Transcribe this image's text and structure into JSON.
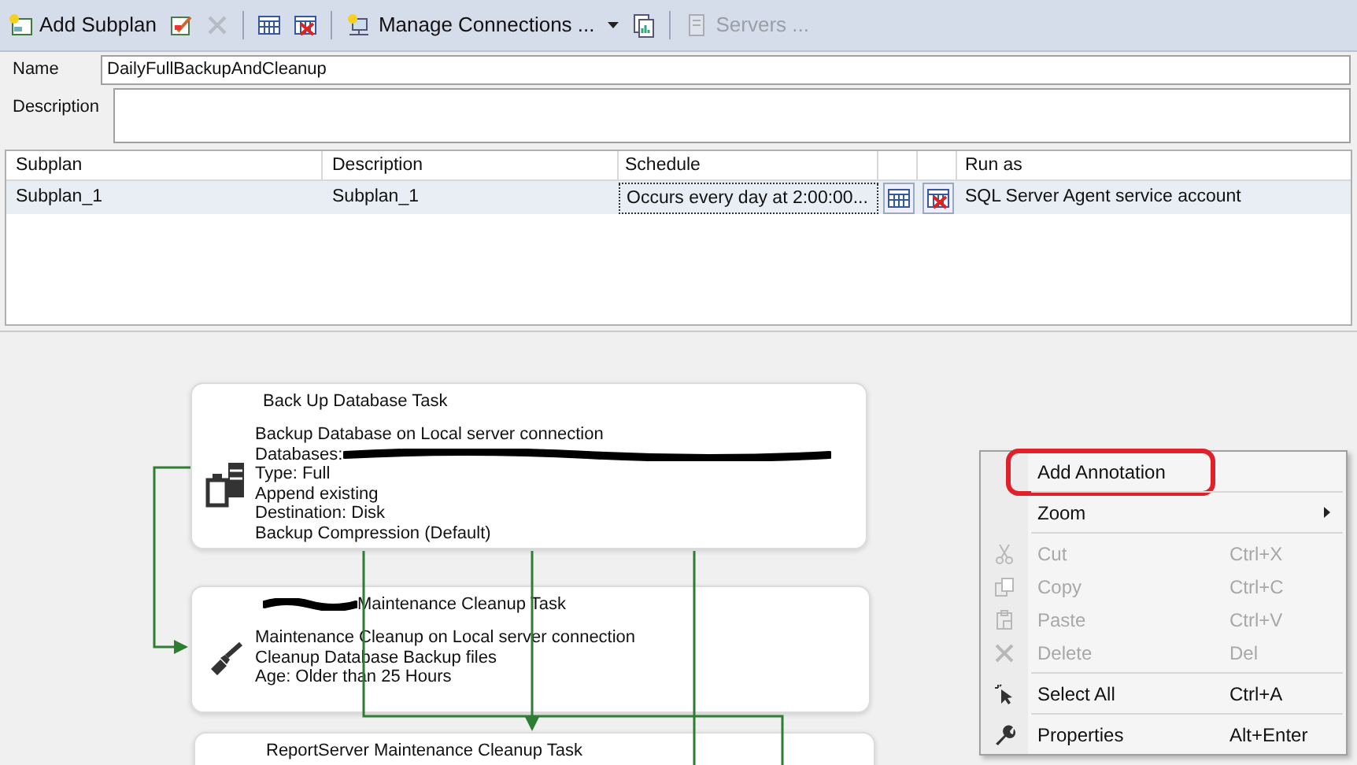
{
  "toolbar": [
    {
      "kind": "button",
      "label": "Add Subplan",
      "disabled": false
    },
    {
      "kind": "icon",
      "disabled": false
    },
    {
      "kind": "icon",
      "disabled": true
    },
    {
      "kind": "separator"
    },
    {
      "kind": "icon",
      "disabled": false
    },
    {
      "kind": "icon",
      "disabled": false
    },
    {
      "kind": "separator"
    },
    {
      "kind": "dropdown",
      "label": "Manage Connections ...",
      "disabled": false
    },
    {
      "kind": "icon",
      "disabled": false
    },
    {
      "kind": "separator"
    },
    {
      "kind": "button",
      "label": "Servers ...",
      "disabled": true
    }
  ],
  "name": {
    "label": "Name",
    "value": "DailyFullBackupAndCleanup"
  },
  "description": {
    "label": "Description"
  },
  "subplans": {
    "columns": [
      "Subplan",
      "Description",
      "Schedule",
      "Run as"
    ],
    "rows": [
      {
        "subplan": "Subplan_1",
        "description": "Subplan_1",
        "schedule": "Occurs every day at 2:00:00...",
        "run_as": "SQL Server Agent service account",
        "selected": true
      }
    ]
  },
  "tasks": [
    {
      "kind": "backup",
      "title": "Back Up Database Task",
      "redacted": false,
      "lines": [
        {
          "text": "Backup Database on Local server connection",
          "redacted": false
        },
        {
          "text": "Databases:",
          "redacted": true
        },
        {
          "text": "Type: Full",
          "redacted": false
        },
        {
          "text": "Append existing",
          "redacted": false
        },
        {
          "text": "Destination: Disk",
          "redacted": false
        },
        {
          "text": "Backup Compression (Default)",
          "redacted": false
        }
      ]
    },
    {
      "kind": "cleanup",
      "title": "Maintenance Cleanup Task",
      "redacted": true,
      "lines": [
        {
          "text": "Maintenance Cleanup on Local server connection",
          "redacted": false
        },
        {
          "text": "Cleanup Database Backup files",
          "redacted": false
        },
        {
          "text": "Age: Older than 25 Hours",
          "redacted": false
        }
      ]
    },
    {
      "kind": "cleanup",
      "title": "ReportServer Maintenance Cleanup Task",
      "redacted": false
    }
  ],
  "context_menu": [
    {
      "kind": "item",
      "label": "Add Annotation",
      "disabled": false,
      "highlighted": true
    },
    {
      "kind": "separator"
    },
    {
      "kind": "submenu",
      "label": "Zoom",
      "disabled": false,
      "highlighted": false
    },
    {
      "kind": "separator"
    },
    {
      "kind": "item",
      "label": "Cut",
      "shortcut": "Ctrl+X",
      "disabled": true,
      "highlighted": false
    },
    {
      "kind": "item",
      "label": "Copy",
      "shortcut": "Ctrl+C",
      "disabled": true,
      "highlighted": false
    },
    {
      "kind": "item",
      "label": "Paste",
      "shortcut": "Ctrl+V",
      "disabled": true,
      "highlighted": false
    },
    {
      "kind": "item",
      "label": "Delete",
      "shortcut": "Del",
      "disabled": true,
      "highlighted": false
    },
    {
      "kind": "separator"
    },
    {
      "kind": "item",
      "label": "Select All",
      "shortcut": "Ctrl+A",
      "disabled": false,
      "highlighted": false
    },
    {
      "kind": "separator"
    },
    {
      "kind": "item",
      "label": "Properties",
      "shortcut": "Alt+Enter",
      "disabled": false,
      "highlighted": false
    }
  ]
}
